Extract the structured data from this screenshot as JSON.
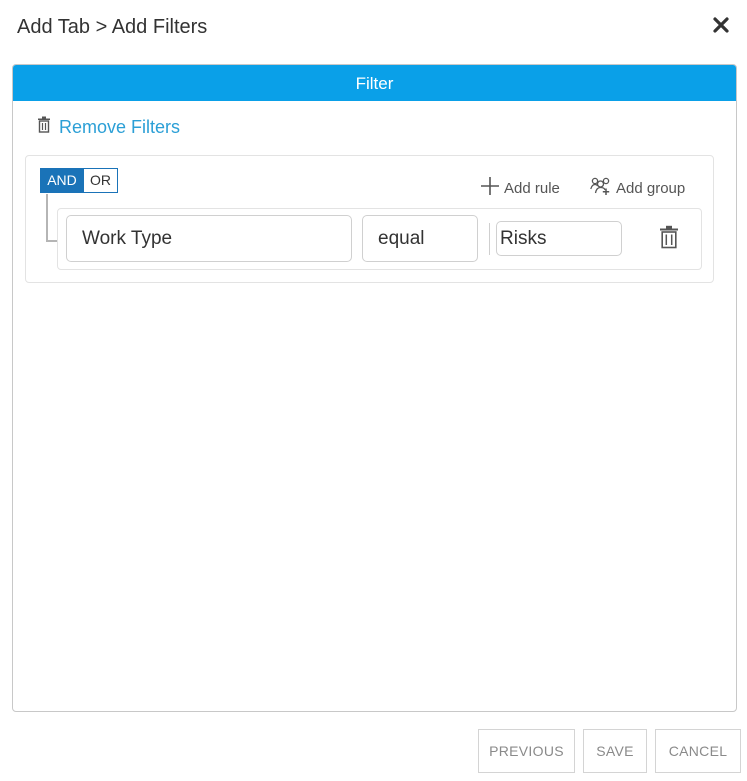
{
  "dialog": {
    "title": "Add Tab > Add Filters",
    "close_icon": "close-icon"
  },
  "panel": {
    "header": "Filter",
    "remove_filters_label": "Remove Filters",
    "remove_filters_icon": "trash-icon"
  },
  "builder": {
    "conditions": [
      "AND",
      "OR"
    ],
    "active_condition": "AND",
    "add_rule_label": "Add rule",
    "add_group_label": "Add group",
    "rule": {
      "attribute": "Work Type",
      "operator": "equal",
      "value": "Risks"
    }
  },
  "footer": {
    "previous_label": "PREVIOUS",
    "save_label": "SAVE",
    "cancel_label": "CANCEL"
  },
  "colors": {
    "header_bg": "#0aa0e8",
    "link": "#2b9fd6",
    "condition_active": "#1a73b8"
  }
}
